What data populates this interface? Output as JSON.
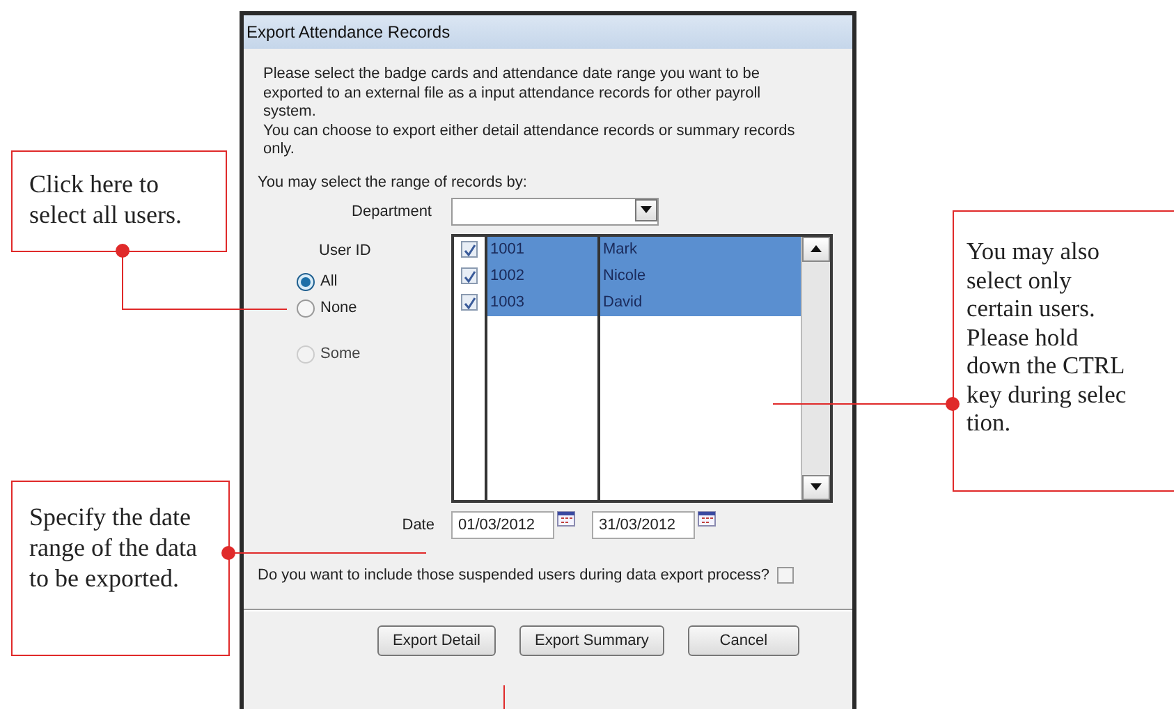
{
  "dialog": {
    "title": "Export Attendance Records",
    "intro": [
      "Please select the badge cards and attendance date range you want to be exported to an external file as a input attendance records for other payroll system.",
      "You can choose to export either detail attendance records or summary records only."
    ],
    "range_label": "You may select the range of records by:",
    "department": {
      "label": "Department"
    },
    "user_id": {
      "label": "User ID",
      "options": [
        {
          "label": "All",
          "selected": true,
          "disabled": false
        },
        {
          "label": "None",
          "selected": false,
          "disabled": false
        },
        {
          "label": "Some",
          "selected": false,
          "disabled": true
        }
      ]
    },
    "users": [
      {
        "id": "1001",
        "name": "Mark",
        "checked": true,
        "selected": true
      },
      {
        "id": "1002",
        "name": "Nicole",
        "checked": true,
        "selected": true
      },
      {
        "id": "1003",
        "name": "David",
        "checked": true,
        "selected": true
      }
    ],
    "date": {
      "label": "Date",
      "from": "01/03/2012",
      "to": "31/03/2012"
    },
    "suspended": {
      "label": "Do you want to include those suspended users during data export process?",
      "checked": false
    },
    "buttons": [
      "Export Detail",
      "Export Summary",
      "Cancel"
    ]
  },
  "callouts": [
    {
      "text": "Click here to select all users."
    },
    {
      "text": "Specify the date range of the data to be exported."
    },
    {
      "text": "You may also select only certain users. Please hold down the CTRL key during selec tion."
    }
  ]
}
